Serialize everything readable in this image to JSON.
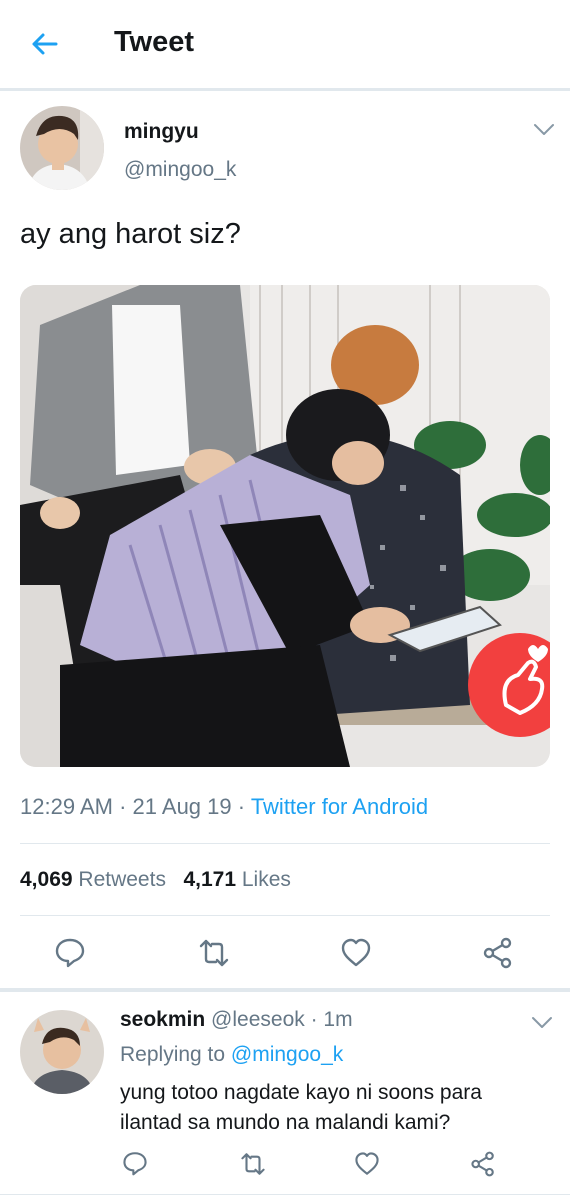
{
  "header": {
    "title": "Tweet"
  },
  "tweet": {
    "author_name": "mingyu",
    "author_handle": "@mingoo_k",
    "text": "ay ang harot siz?",
    "time": "12:29 AM",
    "date": "21 Aug 19",
    "source": "Twitter for Android",
    "retweets_count": "4,069",
    "retweets_label": "Retweets",
    "likes_count": "4,171",
    "likes_label": "Likes"
  },
  "reply": {
    "author_name": "seokmin",
    "author_handle": "@leeseok",
    "time_ago": "1m",
    "replying_label": "Replying to",
    "replying_handle": "@mingoo_k",
    "text": "yung totoo nagdate kayo ni soons para ilantad sa mundo na malandi kami?"
  },
  "icons": {
    "back": "arrow-left-icon",
    "caret": "chevron-down-icon",
    "reply": "comment-icon",
    "retweet": "retweet-icon",
    "like": "heart-icon",
    "share": "share-icon",
    "finger_heart": "finger-heart-icon"
  },
  "colors": {
    "accent": "#1da1f2",
    "secondary_text": "#657786",
    "divider": "#e1e8ed",
    "finger_heart_bg": "#f2403f"
  }
}
